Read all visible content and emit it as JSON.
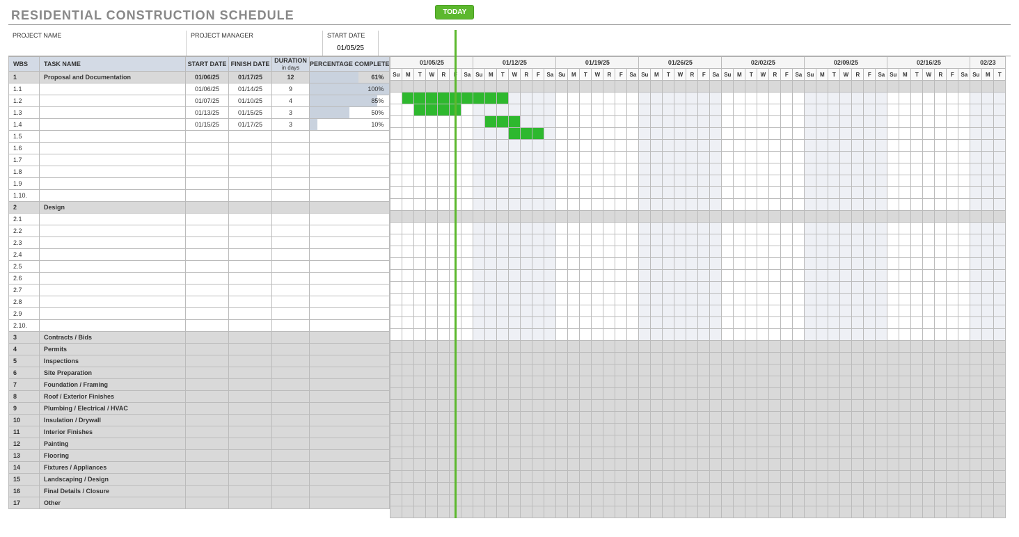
{
  "title": "RESIDENTIAL CONSTRUCTION SCHEDULE",
  "meta": {
    "project_name_label": "PROJECT NAME",
    "project_name_value": "",
    "project_manager_label": "PROJECT MANAGER",
    "project_manager_value": "",
    "start_date_label": "START DATE",
    "start_date_value": "01/05/25"
  },
  "headers": {
    "wbs": "WBS",
    "task": "TASK NAME",
    "start": "START DATE",
    "finish": "FINISH DATE",
    "duration": "DURATION",
    "duration_sub": "in days",
    "percentage": "PERCENTAGE COMPLETE"
  },
  "today_label": "TODAY",
  "today_col": 5,
  "week_starts": [
    "01/05/25",
    "01/12/25",
    "01/19/25",
    "01/26/25",
    "02/02/25",
    "02/09/25",
    "02/16/25",
    "02/23"
  ],
  "day_labels": [
    "Su",
    "M",
    "T",
    "W",
    "R",
    "F",
    "Sa"
  ],
  "first_week_offset": 0,
  "shaded_weeks": [
    1,
    3,
    5,
    7
  ],
  "rows": [
    {
      "wbs": "1",
      "task": "Proposal and Documentation",
      "start": "01/06/25",
      "finish": "01/17/25",
      "dur": "12",
      "pct": 61,
      "phase": true,
      "bar": null
    },
    {
      "wbs": "1.1",
      "task": "",
      "start": "01/06/25",
      "finish": "01/14/25",
      "dur": "9",
      "pct": 100,
      "phase": false,
      "bar": {
        "from": 1,
        "to": 9
      }
    },
    {
      "wbs": "1.2",
      "task": "",
      "start": "01/07/25",
      "finish": "01/10/25",
      "dur": "4",
      "pct": 85,
      "phase": false,
      "bar": {
        "from": 2,
        "to": 5
      }
    },
    {
      "wbs": "1.3",
      "task": "",
      "start": "01/13/25",
      "finish": "01/15/25",
      "dur": "3",
      "pct": 50,
      "phase": false,
      "bar": {
        "from": 8,
        "to": 10
      }
    },
    {
      "wbs": "1.4",
      "task": "",
      "start": "01/15/25",
      "finish": "01/17/25",
      "dur": "3",
      "pct": 10,
      "phase": false,
      "bar": {
        "from": 10,
        "to": 12
      }
    },
    {
      "wbs": "1.5",
      "task": "",
      "start": "",
      "finish": "",
      "dur": "",
      "pct": null,
      "phase": false,
      "bar": null
    },
    {
      "wbs": "1.6",
      "task": "",
      "start": "",
      "finish": "",
      "dur": "",
      "pct": null,
      "phase": false,
      "bar": null
    },
    {
      "wbs": "1.7",
      "task": "",
      "start": "",
      "finish": "",
      "dur": "",
      "pct": null,
      "phase": false,
      "bar": null
    },
    {
      "wbs": "1.8",
      "task": "",
      "start": "",
      "finish": "",
      "dur": "",
      "pct": null,
      "phase": false,
      "bar": null
    },
    {
      "wbs": "1.9",
      "task": "",
      "start": "",
      "finish": "",
      "dur": "",
      "pct": null,
      "phase": false,
      "bar": null
    },
    {
      "wbs": "1.10.",
      "task": "",
      "start": "",
      "finish": "",
      "dur": "",
      "pct": null,
      "phase": false,
      "bar": null
    },
    {
      "wbs": "2",
      "task": "Design",
      "start": "",
      "finish": "",
      "dur": "",
      "pct": null,
      "phase": true,
      "bar": null
    },
    {
      "wbs": "2.1",
      "task": "",
      "start": "",
      "finish": "",
      "dur": "",
      "pct": null,
      "phase": false,
      "bar": null
    },
    {
      "wbs": "2.2",
      "task": "",
      "start": "",
      "finish": "",
      "dur": "",
      "pct": null,
      "phase": false,
      "bar": null
    },
    {
      "wbs": "2.3",
      "task": "",
      "start": "",
      "finish": "",
      "dur": "",
      "pct": null,
      "phase": false,
      "bar": null
    },
    {
      "wbs": "2.4",
      "task": "",
      "start": "",
      "finish": "",
      "dur": "",
      "pct": null,
      "phase": false,
      "bar": null
    },
    {
      "wbs": "2.5",
      "task": "",
      "start": "",
      "finish": "",
      "dur": "",
      "pct": null,
      "phase": false,
      "bar": null
    },
    {
      "wbs": "2.6",
      "task": "",
      "start": "",
      "finish": "",
      "dur": "",
      "pct": null,
      "phase": false,
      "bar": null
    },
    {
      "wbs": "2.7",
      "task": "",
      "start": "",
      "finish": "",
      "dur": "",
      "pct": null,
      "phase": false,
      "bar": null
    },
    {
      "wbs": "2.8",
      "task": "",
      "start": "",
      "finish": "",
      "dur": "",
      "pct": null,
      "phase": false,
      "bar": null
    },
    {
      "wbs": "2.9",
      "task": "",
      "start": "",
      "finish": "",
      "dur": "",
      "pct": null,
      "phase": false,
      "bar": null
    },
    {
      "wbs": "2.10.",
      "task": "",
      "start": "",
      "finish": "",
      "dur": "",
      "pct": null,
      "phase": false,
      "bar": null
    },
    {
      "wbs": "3",
      "task": "Contracts / Bids",
      "start": "",
      "finish": "",
      "dur": "",
      "pct": null,
      "phase": true,
      "bar": null
    },
    {
      "wbs": "4",
      "task": "Permits",
      "start": "",
      "finish": "",
      "dur": "",
      "pct": null,
      "phase": true,
      "bar": null
    },
    {
      "wbs": "5",
      "task": "Inspections",
      "start": "",
      "finish": "",
      "dur": "",
      "pct": null,
      "phase": true,
      "bar": null
    },
    {
      "wbs": "6",
      "task": "Site Preparation",
      "start": "",
      "finish": "",
      "dur": "",
      "pct": null,
      "phase": true,
      "bar": null
    },
    {
      "wbs": "7",
      "task": "Foundation / Framing",
      "start": "",
      "finish": "",
      "dur": "",
      "pct": null,
      "phase": true,
      "bar": null
    },
    {
      "wbs": "8",
      "task": "Roof / Exterior Finishes",
      "start": "",
      "finish": "",
      "dur": "",
      "pct": null,
      "phase": true,
      "bar": null
    },
    {
      "wbs": "9",
      "task": "Plumbing / Electrical / HVAC",
      "start": "",
      "finish": "",
      "dur": "",
      "pct": null,
      "phase": true,
      "bar": null
    },
    {
      "wbs": "10",
      "task": "Insulation / Drywall",
      "start": "",
      "finish": "",
      "dur": "",
      "pct": null,
      "phase": true,
      "bar": null
    },
    {
      "wbs": "11",
      "task": "Interior Finishes",
      "start": "",
      "finish": "",
      "dur": "",
      "pct": null,
      "phase": true,
      "bar": null
    },
    {
      "wbs": "12",
      "task": "Painting",
      "start": "",
      "finish": "",
      "dur": "",
      "pct": null,
      "phase": true,
      "bar": null
    },
    {
      "wbs": "13",
      "task": "Flooring",
      "start": "",
      "finish": "",
      "dur": "",
      "pct": null,
      "phase": true,
      "bar": null
    },
    {
      "wbs": "14",
      "task": "Fixtures / Appliances",
      "start": "",
      "finish": "",
      "dur": "",
      "pct": null,
      "phase": true,
      "bar": null
    },
    {
      "wbs": "15",
      "task": "Landscaping / Design",
      "start": "",
      "finish": "",
      "dur": "",
      "pct": null,
      "phase": true,
      "bar": null
    },
    {
      "wbs": "16",
      "task": "Final Details / Closure",
      "start": "",
      "finish": "",
      "dur": "",
      "pct": null,
      "phase": true,
      "bar": null
    },
    {
      "wbs": "17",
      "task": "Other",
      "start": "",
      "finish": "",
      "dur": "",
      "pct": null,
      "phase": true,
      "bar": null
    }
  ]
}
